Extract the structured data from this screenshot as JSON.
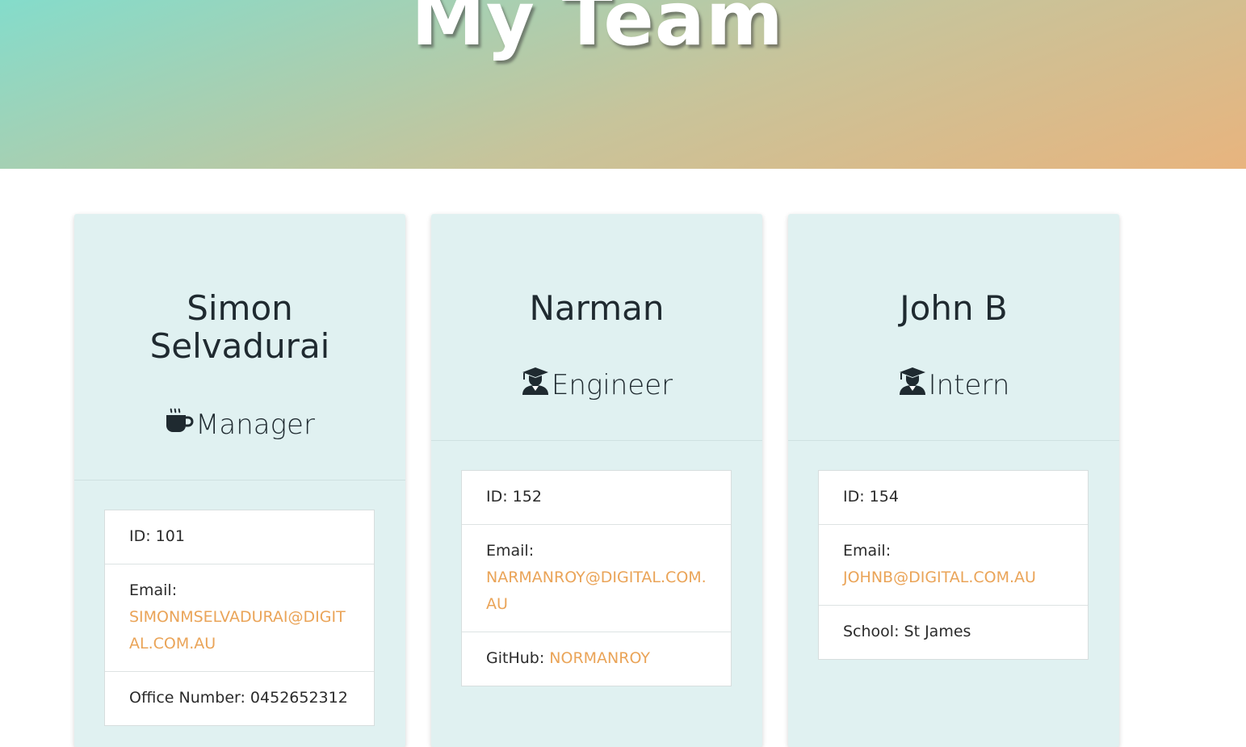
{
  "header": {
    "title": "My Team"
  },
  "cards": [
    {
      "name": "Simon Selvadurai",
      "role": "Manager",
      "role_icon": "coffee-icon",
      "id": "ID: 101",
      "email_label": "Email:",
      "email": "SIMONMSELVADURAI@DIGITAL.COM.AU",
      "extra": "Office Number: 0452652312"
    },
    {
      "name": "Narman",
      "role": "Engineer",
      "role_icon": "graduate-icon",
      "id": "ID: 152",
      "email_label": "Email:",
      "email": "NARMANROY@DIGITAL.COM.AU",
      "extra_label": "GitHub:",
      "extra_link": "NORMANROY"
    },
    {
      "name": "John B",
      "role": "Intern",
      "role_icon": "graduate-icon",
      "id": "ID: 154",
      "email_label": "Email:",
      "email": "JOHNB@DIGITAL.COM.AU",
      "extra": "School: St James"
    }
  ],
  "colors": {
    "card_bg": "#e0f1f1",
    "link": "#eaa458",
    "gradient_start": "#84dccb",
    "gradient_end": "#e8b47e"
  }
}
